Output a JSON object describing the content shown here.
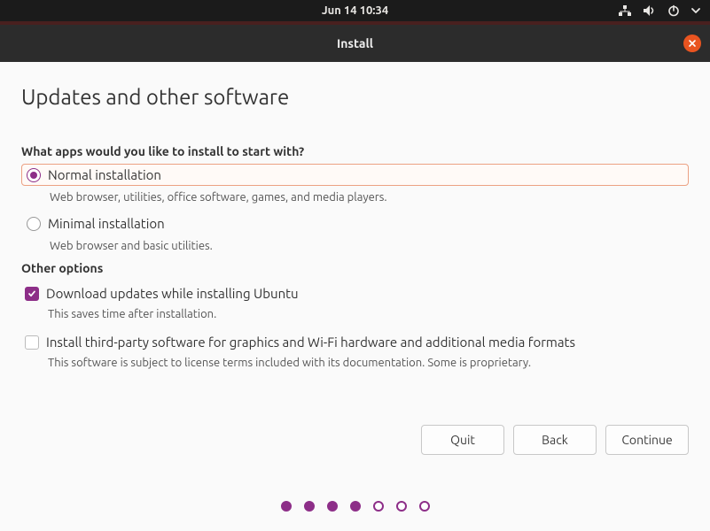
{
  "topbar": {
    "datetime": "Jun 14  10:34"
  },
  "window": {
    "title": "Install"
  },
  "page": {
    "heading": "Updates and other software"
  },
  "apps_section": {
    "question": "What apps would you like to install to start with?",
    "options": [
      {
        "label": "Normal installation",
        "desc": "Web browser, utilities, office software, games, and media players.",
        "selected": true
      },
      {
        "label": "Minimal installation",
        "desc": "Web browser and basic utilities.",
        "selected": false
      }
    ]
  },
  "other_section": {
    "title": "Other options",
    "options": [
      {
        "label": "Download updates while installing Ubuntu",
        "desc": "This saves time after installation.",
        "checked": true
      },
      {
        "label": "Install third-party software for graphics and Wi-Fi hardware and additional media formats",
        "desc": "This software is subject to license terms included with its documentation. Some is proprietary.",
        "checked": false
      }
    ]
  },
  "buttons": {
    "quit": "Quit",
    "back": "Back",
    "continue": "Continue"
  },
  "progress": {
    "total": 7,
    "current": 4
  }
}
